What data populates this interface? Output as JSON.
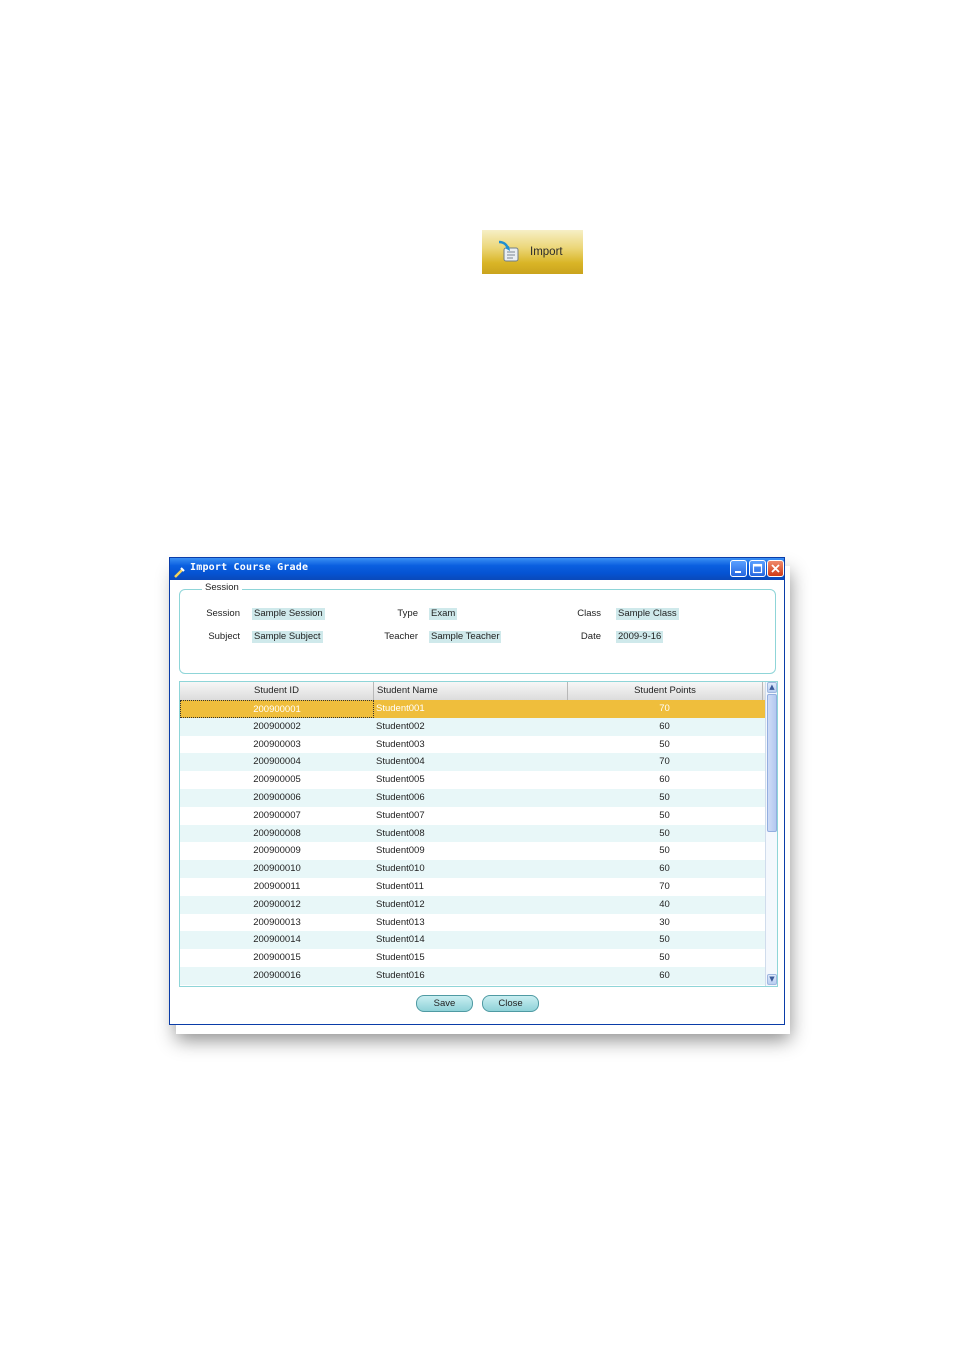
{
  "toolbar": {
    "import_label": "Import"
  },
  "window": {
    "title": "Import Course Grade",
    "controls": {
      "minimize": "minimize",
      "maximize": "maximize",
      "close": "close"
    }
  },
  "session": {
    "legend": "Session",
    "fields": {
      "session_label": "Session",
      "session_value": "Sample Session",
      "type_label": "Type",
      "type_value": "Exam",
      "class_label": "Class",
      "class_value": "Sample Class",
      "subject_label": "Subject",
      "subject_value": "Sample Subject",
      "teacher_label": "Teacher",
      "teacher_value": "Sample Teacher",
      "date_label": "Date",
      "date_value": "2009-9-16"
    }
  },
  "grid": {
    "columns": [
      "Student ID",
      "Student Name",
      "Student Points"
    ],
    "rows": [
      [
        "200900001",
        "Student001",
        "70"
      ],
      [
        "200900002",
        "Student002",
        "60"
      ],
      [
        "200900003",
        "Student003",
        "50"
      ],
      [
        "200900004",
        "Student004",
        "70"
      ],
      [
        "200900005",
        "Student005",
        "60"
      ],
      [
        "200900006",
        "Student006",
        "50"
      ],
      [
        "200900007",
        "Student007",
        "50"
      ],
      [
        "200900008",
        "Student008",
        "50"
      ],
      [
        "200900009",
        "Student009",
        "50"
      ],
      [
        "200900010",
        "Student010",
        "60"
      ],
      [
        "200900011",
        "Student011",
        "70"
      ],
      [
        "200900012",
        "Student012",
        "40"
      ],
      [
        "200900013",
        "Student013",
        "30"
      ],
      [
        "200900014",
        "Student014",
        "50"
      ],
      [
        "200900015",
        "Student015",
        "50"
      ],
      [
        "200900016",
        "Student016",
        "60"
      ]
    ],
    "selected_row": 0
  },
  "buttons": {
    "save_label": "Save",
    "close_label": "Close"
  },
  "colors": {
    "titlebar": "#0553d2",
    "selection": "#efbe3c",
    "alt_row": "#e8f7f8",
    "accent_border": "#8fd5d8",
    "import_button": "#d9b526"
  }
}
